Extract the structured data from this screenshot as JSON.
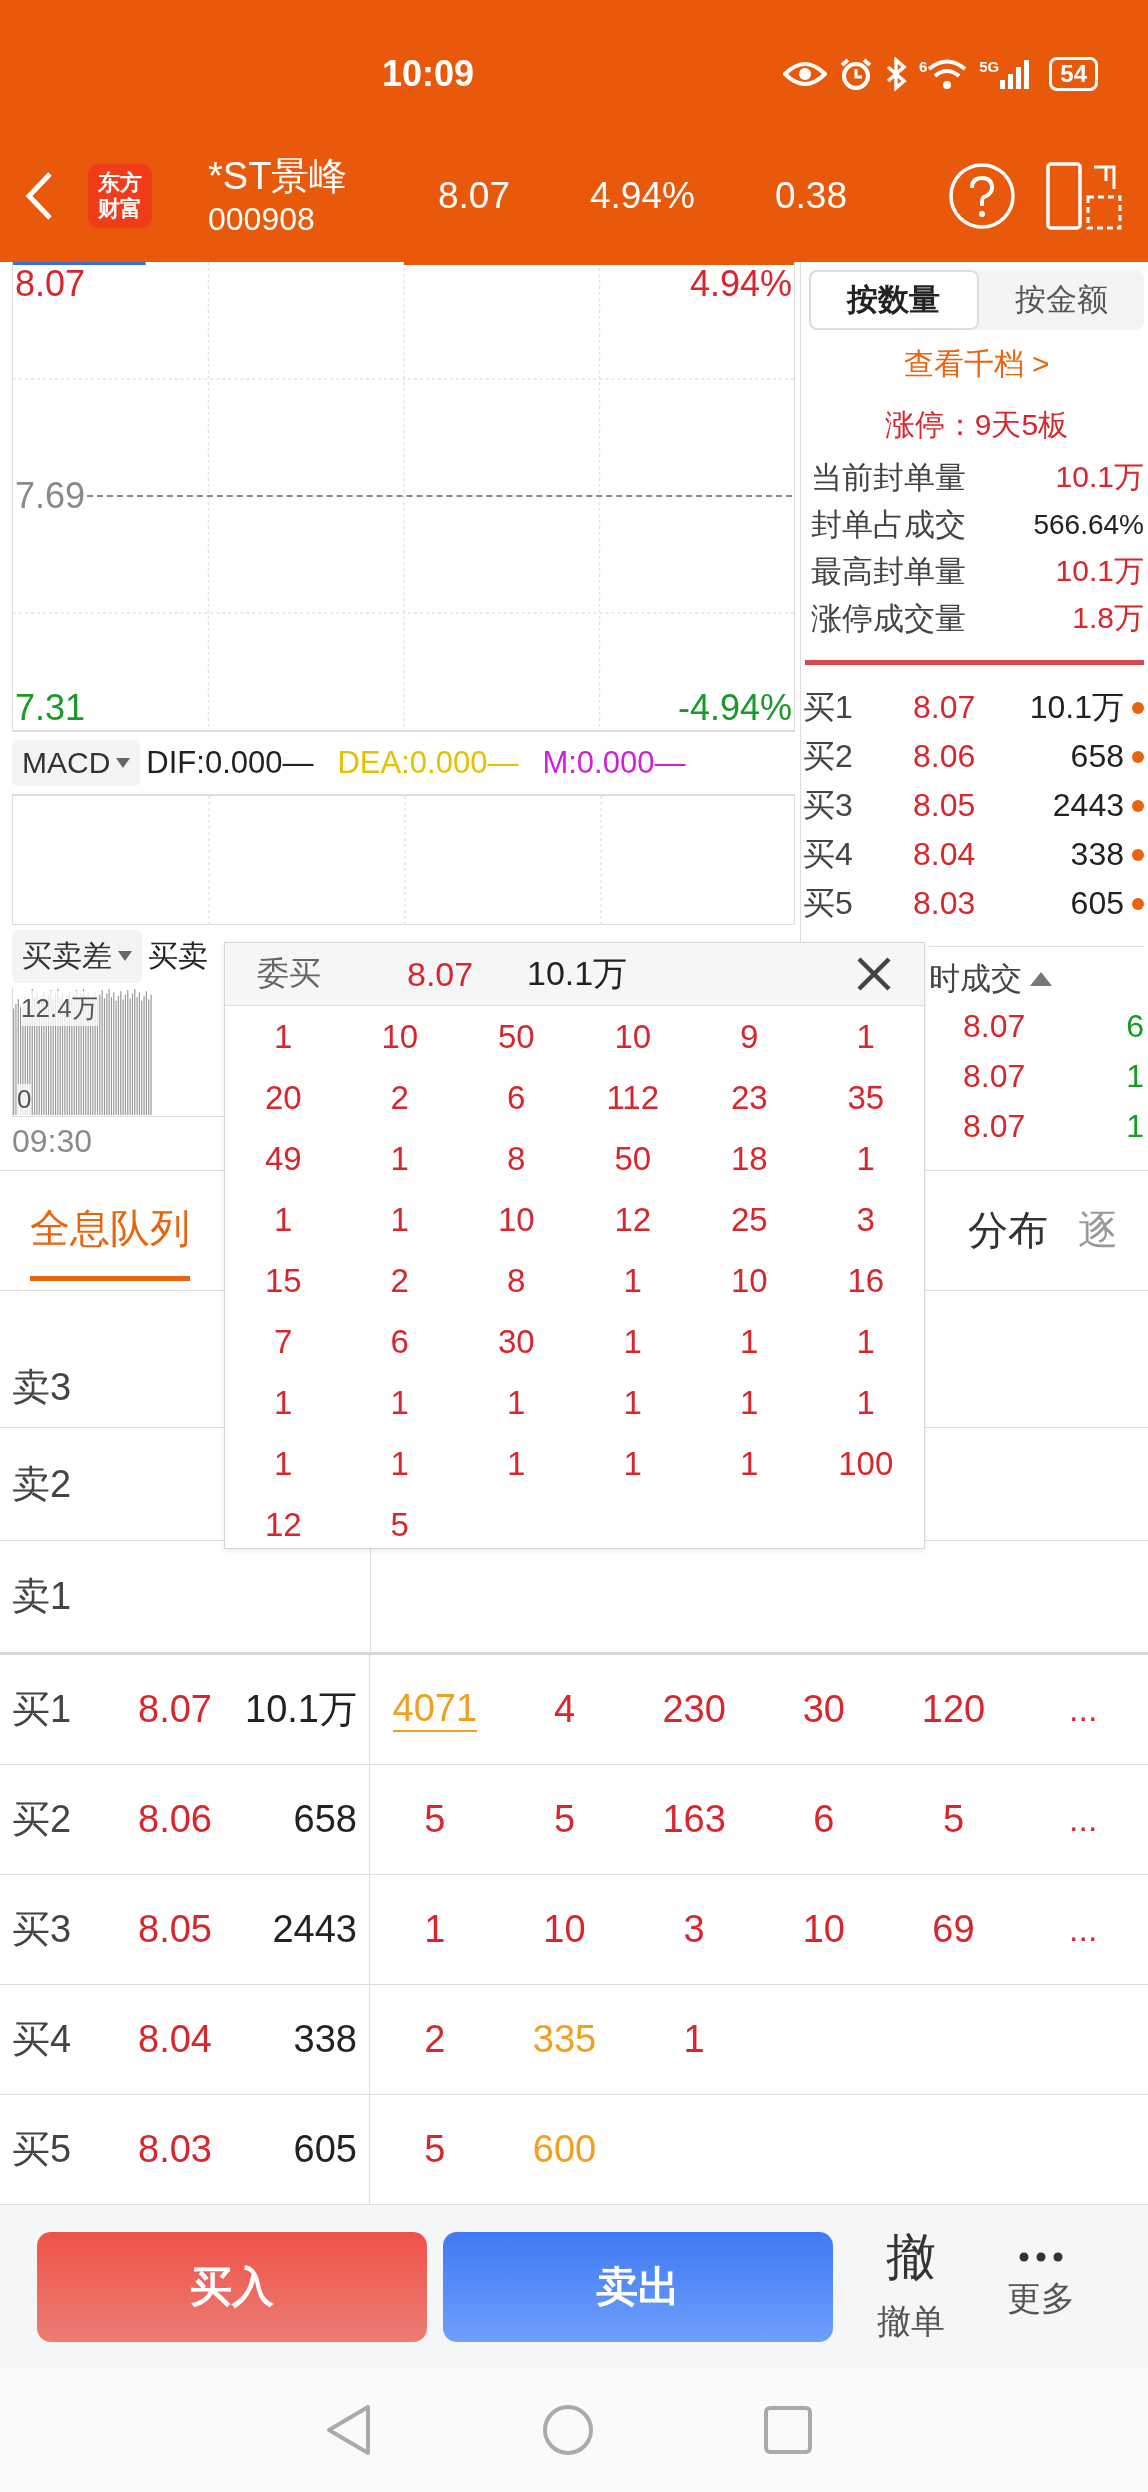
{
  "status_bar": {
    "time": "10:09",
    "wifi_badge": "6",
    "network": "5G",
    "battery": "54"
  },
  "header": {
    "logo": [
      "东方",
      "财富"
    ],
    "name": "*ST景峰",
    "code": "000908",
    "price": "8.07",
    "change_pct": "4.94%",
    "change": "0.38"
  },
  "price_chart": {
    "high": "8.07",
    "high_pct": "4.94%",
    "prev_close": "7.69",
    "low": "7.31",
    "low_pct": "-4.94%"
  },
  "macd": {
    "selector": "MACD",
    "indicators": [
      {
        "text": "DIF:0.000—",
        "color": "#222222"
      },
      {
        "text": "DEA:0.000—",
        "color": "#e8c000"
      },
      {
        "text": "M:0.000—",
        "color": "#d21fd6"
      }
    ]
  },
  "diff_chart": {
    "selector": "买卖差",
    "legend": "买卖",
    "max_label": "12.4万",
    "min_label": "0",
    "time": "09:30"
  },
  "side_panel": {
    "tabs": [
      {
        "label": "按数量",
        "selected": true
      },
      {
        "label": "按金额",
        "selected": false
      }
    ],
    "depth_link": "查看千档 >",
    "limit_info": "涨停：9天5板",
    "stats": [
      {
        "label": "当前封单量",
        "value": "10.1万",
        "kind": "amount"
      },
      {
        "label": "封单占成交",
        "value": "566.64%",
        "kind": "percent"
      },
      {
        "label": "最高封单量",
        "value": "10.1万",
        "kind": "amount"
      },
      {
        "label": "涨停成交量",
        "value": "1.8万",
        "kind": "amount"
      }
    ],
    "book": [
      {
        "label": "买1",
        "price": "8.07",
        "volume": "10.1万"
      },
      {
        "label": "买2",
        "price": "8.06",
        "volume": "658"
      },
      {
        "label": "买3",
        "price": "8.05",
        "volume": "2443"
      },
      {
        "label": "买4",
        "price": "8.04",
        "volume": "338"
      },
      {
        "label": "买5",
        "price": "8.03",
        "volume": "605"
      }
    ],
    "trades_title": "时成交",
    "trades": [
      {
        "price": "8.07",
        "volume": "6"
      },
      {
        "price": "8.07",
        "volume": "1"
      },
      {
        "price": "8.07",
        "volume": "1"
      }
    ]
  },
  "queue_tabs": [
    {
      "label": "全息队列",
      "selected": true
    },
    {
      "label": "分布",
      "selected": false
    },
    {
      "label": "逐",
      "selected": false
    }
  ],
  "sell_rows": [
    {
      "label": "卖3"
    },
    {
      "label": "卖2"
    },
    {
      "label": "卖1"
    }
  ],
  "buy_rows": [
    {
      "label": "买1",
      "price": "8.07",
      "volume": "10.1万",
      "more": "...",
      "queue": [
        {
          "value": "4071",
          "large": true,
          "selected": true
        },
        {
          "value": "4",
          "large": false,
          "selected": false
        },
        {
          "value": "230",
          "large": false,
          "selected": false
        },
        {
          "value": "30",
          "large": false,
          "selected": false
        },
        {
          "value": "120",
          "large": false,
          "selected": false
        }
      ]
    },
    {
      "label": "买2",
      "price": "8.06",
      "volume": "658",
      "more": "...",
      "queue": [
        {
          "value": "5",
          "large": false,
          "selected": false
        },
        {
          "value": "5",
          "large": false,
          "selected": false
        },
        {
          "value": "163",
          "large": false,
          "selected": false
        },
        {
          "value": "6",
          "large": false,
          "selected": false
        },
        {
          "value": "5",
          "large": false,
          "selected": false
        }
      ]
    },
    {
      "label": "买3",
      "price": "8.05",
      "volume": "2443",
      "more": "...",
      "queue": [
        {
          "value": "1",
          "large": false,
          "selected": false
        },
        {
          "value": "10",
          "large": false,
          "selected": false
        },
        {
          "value": "3",
          "large": false,
          "selected": false
        },
        {
          "value": "10",
          "large": false,
          "selected": false
        },
        {
          "value": "69",
          "large": false,
          "selected": false
        }
      ]
    },
    {
      "label": "买4",
      "price": "8.04",
      "volume": "338",
      "queue": [
        {
          "value": "2",
          "large": false,
          "selected": false
        },
        {
          "value": "335",
          "large": true,
          "selected": false
        },
        {
          "value": "1",
          "large": false,
          "selected": false
        }
      ]
    },
    {
      "label": "买5",
      "price": "8.03",
      "volume": "605",
      "queue": [
        {
          "value": "5",
          "large": false,
          "selected": false
        },
        {
          "value": "600",
          "large": true,
          "selected": false
        }
      ]
    }
  ],
  "popup": {
    "title": "委买",
    "price": "8.07",
    "volume": "10.1万",
    "orders": [
      "1",
      "10",
      "50",
      "10",
      "9",
      "1",
      "20",
      "2",
      "6",
      "112",
      "23",
      "35",
      "49",
      "1",
      "8",
      "50",
      "18",
      "1",
      "1",
      "1",
      "10",
      "12",
      "25",
      "3",
      "15",
      "2",
      "8",
      "1",
      "10",
      "16",
      "7",
      "6",
      "30",
      "1",
      "1",
      "1",
      "1",
      "1",
      "1",
      "1",
      "1",
      "1",
      "1",
      "1",
      "1",
      "1",
      "1",
      "100",
      "12",
      "5"
    ]
  },
  "actions": [
    {
      "label": "买入",
      "kind": "buy"
    },
    {
      "label": "卖出",
      "kind": "sell"
    }
  ],
  "tools": [
    {
      "glyph": "撤",
      "label": "撤单",
      "kind": "glyph"
    },
    {
      "label": "更多",
      "kind": "more"
    }
  ]
}
